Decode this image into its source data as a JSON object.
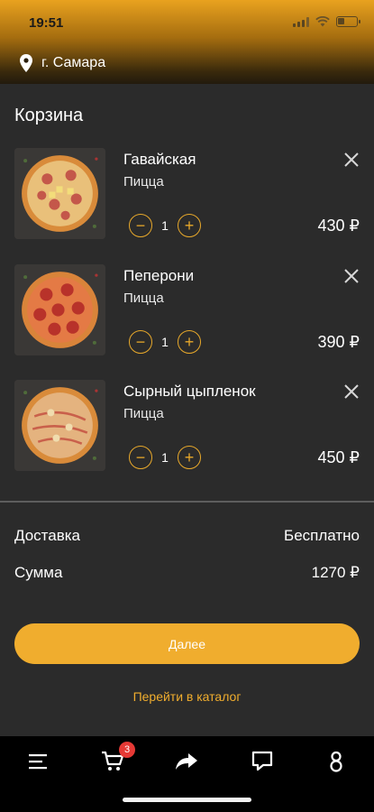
{
  "status_bar": {
    "time": "19:51",
    "battery_level": 0.35
  },
  "location": {
    "city": "г. Самара",
    "icon": "location-pin-icon"
  },
  "page": {
    "title": "Корзина"
  },
  "cart": {
    "items": [
      {
        "name": "Гавайская",
        "category": "Пицца",
        "quantity": "1",
        "price": "430 ₽",
        "topping": "hawaiian"
      },
      {
        "name": "Пеперони",
        "category": "Пицца",
        "quantity": "1",
        "price": "390 ₽",
        "topping": "pepperoni"
      },
      {
        "name": "Сырный цыпленок",
        "category": "Пицца",
        "quantity": "1",
        "price": "450 ₽",
        "topping": "chicken"
      }
    ],
    "decrement_symbol": "−",
    "increment_symbol": "+"
  },
  "summary": {
    "delivery_label": "Доставка",
    "delivery_value": "Бесплатно",
    "total_label": "Сумма",
    "total_value": "1270 ₽"
  },
  "actions": {
    "next_label": "Далее",
    "catalog_label": "Перейти в каталог"
  },
  "bottom_nav": {
    "items": [
      "menu-icon",
      "cart-icon",
      "share-icon",
      "chat-icon",
      "profile-icon"
    ],
    "cart_badge": "3"
  },
  "colors": {
    "accent": "#f0ad2e",
    "background": "#2b2b2b",
    "nav_background": "#000000",
    "badge": "#e53935"
  }
}
